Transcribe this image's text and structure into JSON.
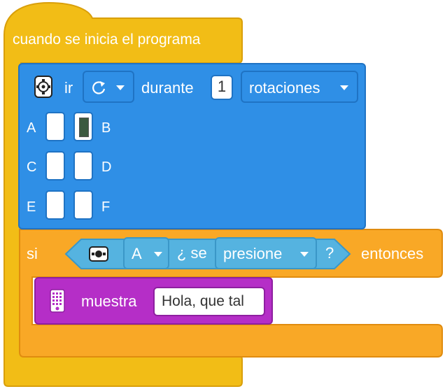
{
  "hat": {
    "label": "cuando se inicia el programa"
  },
  "motor_block": {
    "icon": "motor-icon",
    "verb": "ir",
    "direction_icon": "rotate-clockwise-icon",
    "duration_word": "durante",
    "amount": "1",
    "unit": "rotaciones",
    "ports": {
      "a": "A",
      "b": "B",
      "c": "C",
      "d": "D",
      "e": "E",
      "f": "F"
    },
    "selected_port": "B"
  },
  "if_block": {
    "keyword": "si",
    "then_keyword": "entonces",
    "condition": {
      "icon": "force-sensor-icon",
      "port": "A",
      "question_open": "¿ se",
      "state": "presione",
      "question_close": "?"
    }
  },
  "display_block": {
    "icon": "light-matrix-icon",
    "verb": "muestra",
    "text": "Hola, que tal"
  },
  "colors": {
    "events_yellow": "#f2bd16",
    "motor_blue": "#2f8fe6",
    "control_orange": "#f9a826",
    "sensor_cyan": "#55b3e0",
    "display_purple": "#b52ec7"
  }
}
